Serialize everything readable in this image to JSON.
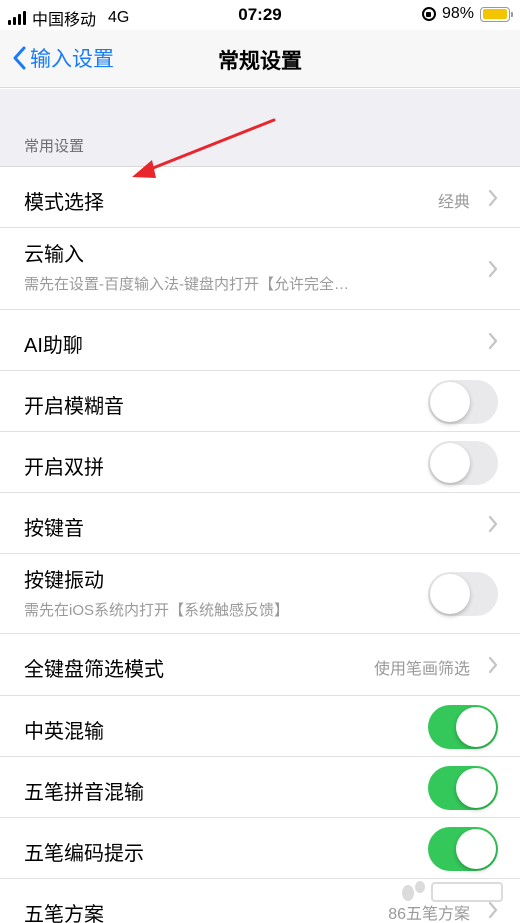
{
  "status_bar": {
    "carrier": "中国移动",
    "network": "4G",
    "time": "07:29",
    "battery_percent": "98%",
    "battery_level": 0.98,
    "battery_color": "#f5c400"
  },
  "nav": {
    "back_label": "输入设置",
    "title": "常规设置",
    "accent_color": "#1a7cf5"
  },
  "section": {
    "header": "常用设置"
  },
  "rows": [
    {
      "label": "模式选择",
      "value": "经典",
      "control": "chevron"
    },
    {
      "label": "云输入",
      "sub": "需先在设置-百度输入法-键盘内打开【允许完全…",
      "control": "chevron"
    },
    {
      "label": "AI助聊",
      "control": "chevron"
    },
    {
      "label": "开启模糊音",
      "control": "toggle",
      "on": false
    },
    {
      "label": "开启双拼",
      "control": "toggle",
      "on": false
    },
    {
      "label": "按键音",
      "control": "chevron"
    },
    {
      "label": "按键振动",
      "sub": "需先在iOS系统内打开【系统触感反馈】",
      "control": "toggle",
      "on": false
    },
    {
      "label": "全键盘筛选模式",
      "value": "使用笔画筛选",
      "control": "chevron"
    },
    {
      "label": "中英混输",
      "control": "toggle",
      "on": true
    },
    {
      "label": "五笔拼音混输",
      "control": "toggle",
      "on": true
    },
    {
      "label": "五笔编码提示",
      "control": "toggle",
      "on": true
    },
    {
      "label": "五笔方案",
      "value": "86五笔方案",
      "control": "chevron"
    }
  ],
  "toggle_on_color": "#34c759",
  "annotation_arrow_color": "#e8262c"
}
